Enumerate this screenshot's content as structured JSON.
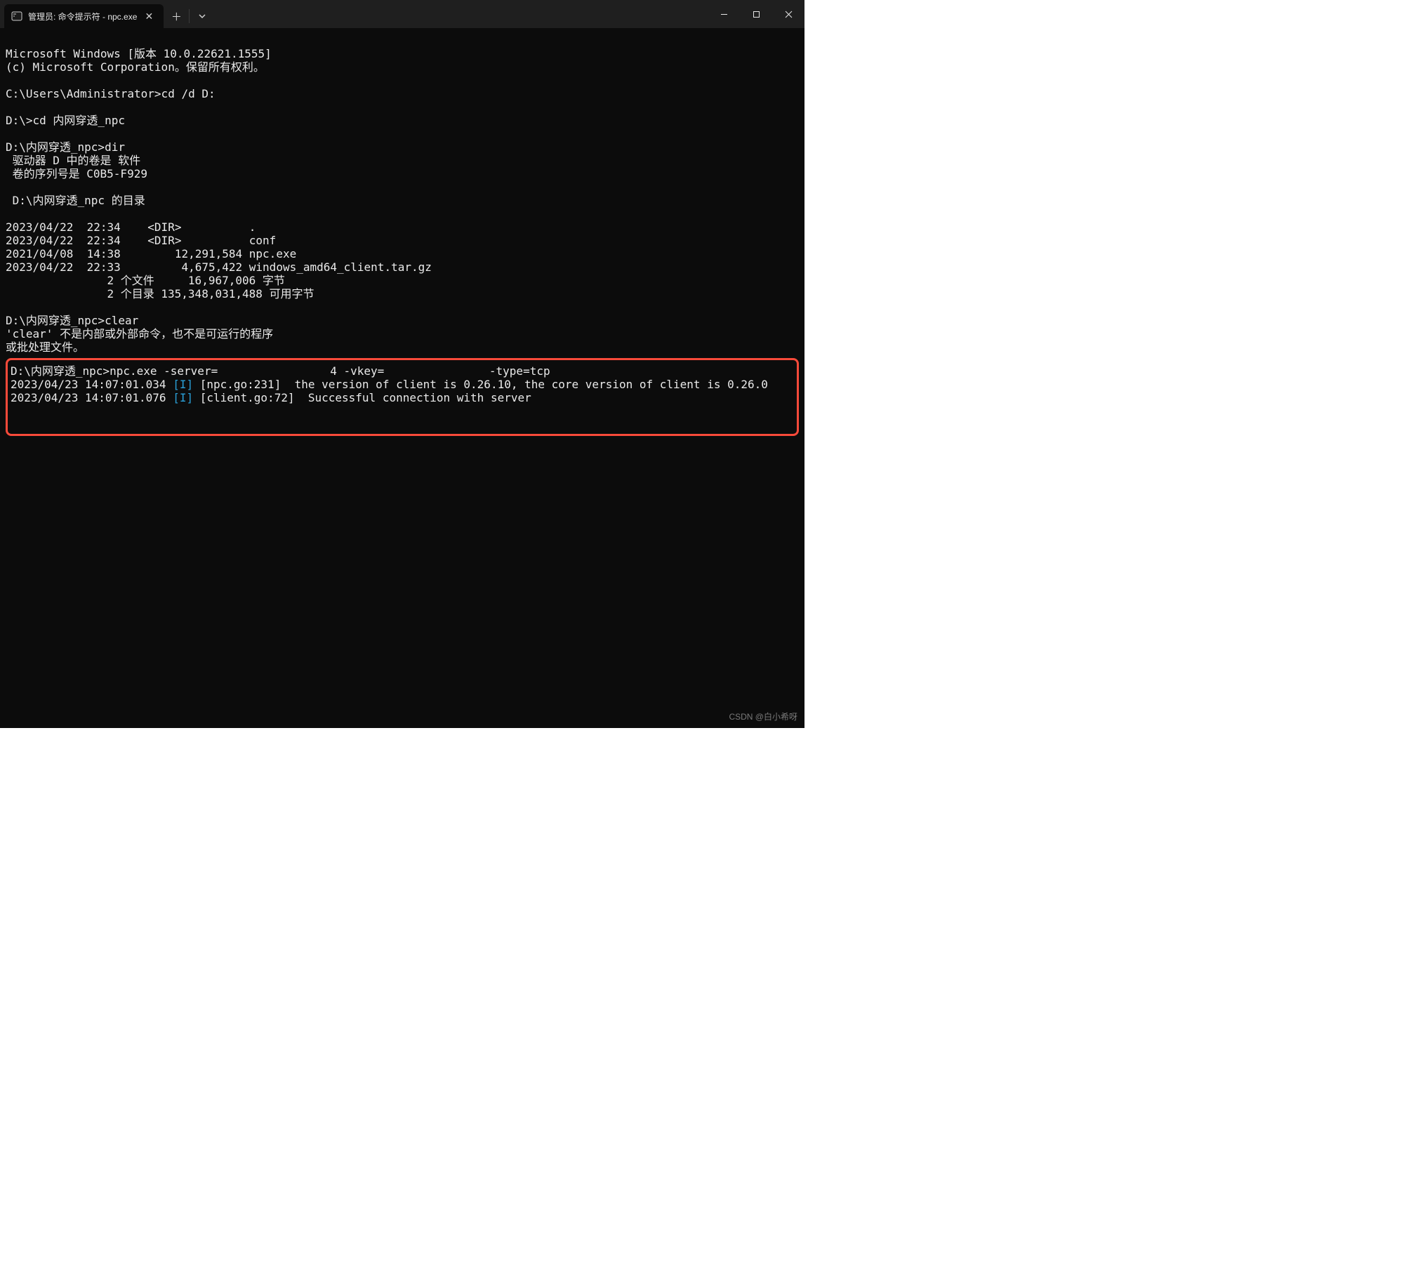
{
  "titlebar": {
    "tab_title": "管理员: 命令提示符 - npc.exe"
  },
  "terminal": {
    "line01": "Microsoft Windows [版本 10.0.22621.1555]",
    "line02": "(c) Microsoft Corporation。保留所有权利。",
    "blank": "",
    "line03": "C:\\Users\\Administrator>cd /d D:",
    "line04": "D:\\>cd 内网穿透_npc",
    "line05": "D:\\内网穿透_npc>dir",
    "line06": " 驱动器 D 中的卷是 软件",
    "line07": " 卷的序列号是 C0B5-F929",
    "line08": " D:\\内网穿透_npc 的目录",
    "line09": "2023/04/22  22:34    <DIR>          .",
    "line10": "2023/04/22  22:34    <DIR>          conf",
    "line11": "2021/04/08  14:38        12,291,584 npc.exe",
    "line12": "2023/04/22  22:33         4,675,422 windows_amd64_client.tar.gz",
    "line13": "               2 个文件     16,967,006 字节",
    "line14": "               2 个目录 135,348,031,488 可用字节",
    "line15": "D:\\内网穿透_npc>clear",
    "line16": "'clear' 不是内部或外部命令，也不是可运行的程序",
    "line17": "或批处理文件。",
    "cmd_prompt": "D:\\内网穿透_npc>",
    "cmd_a": "npc.exe -server=",
    "cmd_b": "4 -vkey=",
    "cmd_c": " -type=tcp",
    "log1_ts": "2023/04/23 14:07:01.034 ",
    "log1_lv": "[I]",
    "log1_rest": " [npc.go:231]  the version of client is 0.26.10, the core version of client is 0.26.0",
    "log2_ts": "2023/04/23 14:07:01.076 ",
    "log2_lv": "[I]",
    "log2_rest_a": " [client.go:72]  Successful connection with server "
  },
  "watermark": "CSDN @白小希呀"
}
